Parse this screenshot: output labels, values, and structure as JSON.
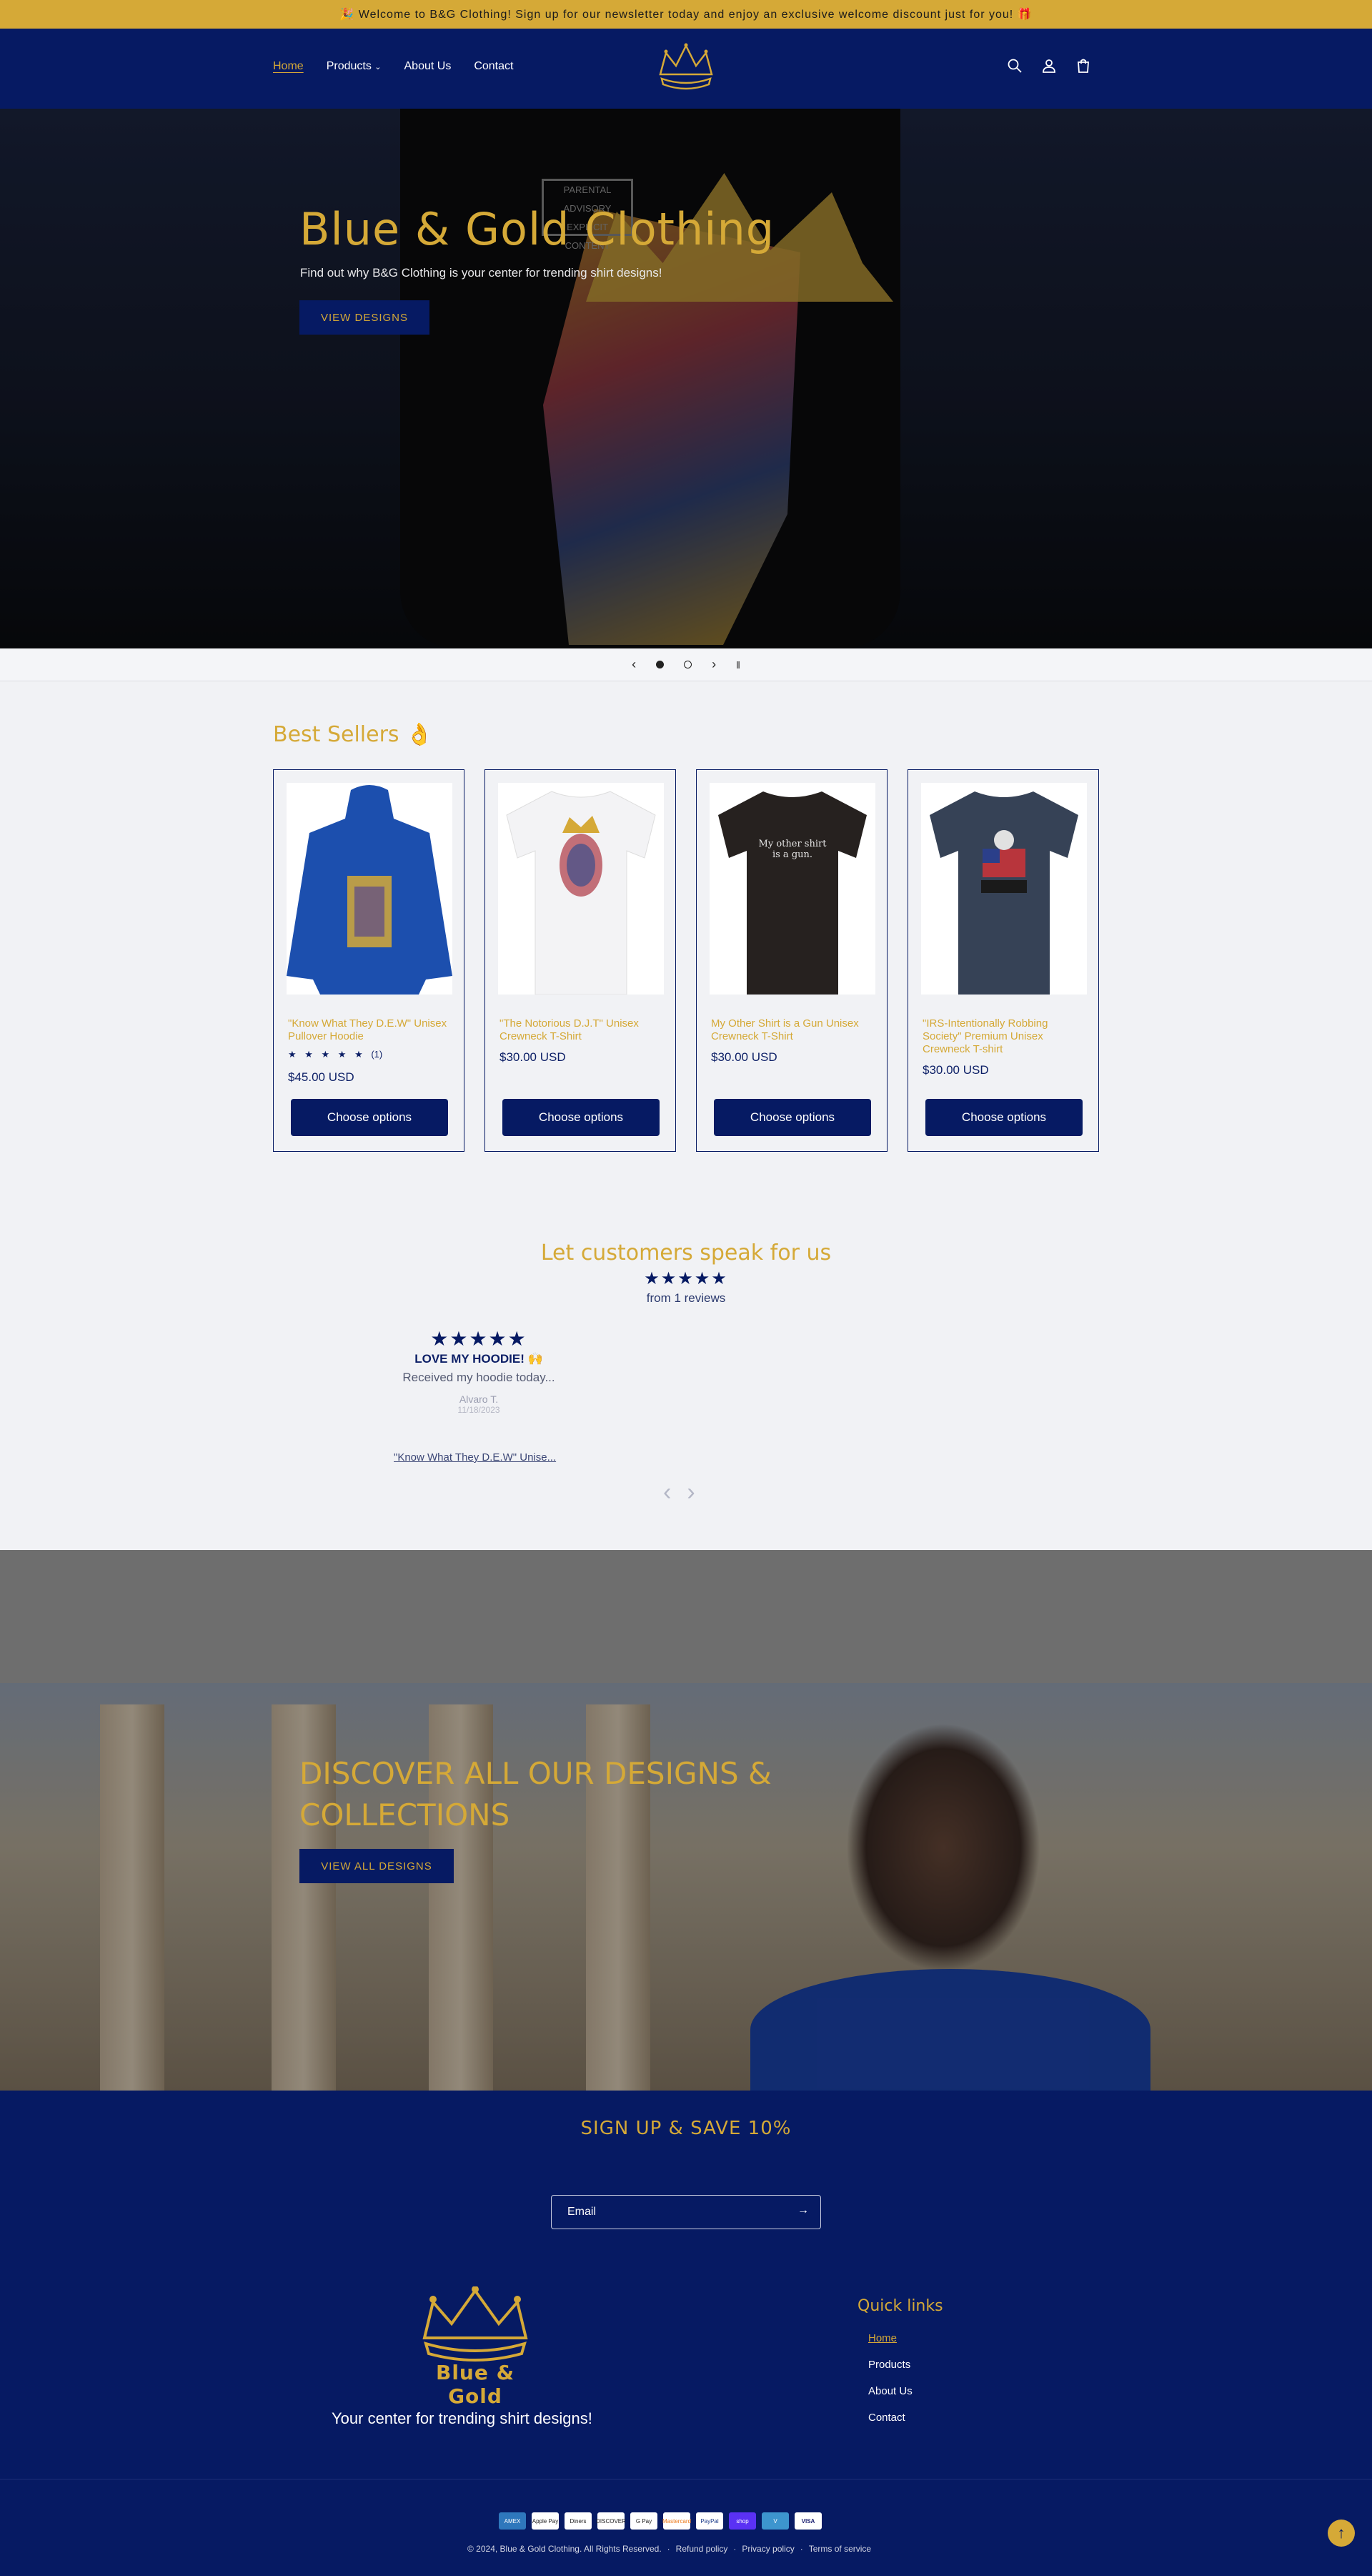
{
  "announcement": "🎉 Welcome to B&G Clothing! Sign up for our newsletter today and enjoy an exclusive welcome discount just for you! 🎁",
  "nav": [
    {
      "label": "Home",
      "active": true
    },
    {
      "label": "Products",
      "has_dropdown": true
    },
    {
      "label": "About Us"
    },
    {
      "label": "Contact"
    }
  ],
  "header_icons": [
    "search-icon",
    "account-icon",
    "cart-icon"
  ],
  "hero": {
    "title": "Blue & Gold Clothing",
    "subtitle": "Find out why B&G Clothing is your center for trending shirt designs!",
    "button": "VIEW DESIGNS",
    "advisory": "PARENTAL ADVISORY EXPLICIT CONTENT"
  },
  "slider": {
    "prev": "‹",
    "next": "›",
    "pause": "‖",
    "slides": 2,
    "current": 1
  },
  "best_sellers": {
    "title": "Best Sellers 👌",
    "products": [
      {
        "name": "\"Know What They D.E.W\" Unisex Pullover Hoodie",
        "rating_stars": "★ ★ ★ ★ ★",
        "rating_count": "(1)",
        "price": "$45.00 USD",
        "button": "Choose options"
      },
      {
        "name": "\"The Notorious D.J.T\" Unisex Crewneck T-Shirt",
        "price": "$30.00 USD",
        "button": "Choose options"
      },
      {
        "name": "My Other Shirt is a Gun Unisex Crewneck T-Shirt",
        "price": "$30.00 USD",
        "button": "Choose options",
        "print": "My other shirt is a gun."
      },
      {
        "name": "\"IRS-Intentionally Robbing Society\" Premium Unisex Crewneck T-shirt",
        "price": "$30.00 USD",
        "button": "Choose options"
      }
    ]
  },
  "reviews": {
    "title": "Let customers speak for us",
    "stars": "★★★★★",
    "from": "from 1 reviews",
    "review": {
      "stars": "★★★★★",
      "title": "LOVE MY HOODIE! 🙌",
      "body": "Received my hoodie today...",
      "author": "Alvaro T.",
      "date": "11/18/2023",
      "product": "\"Know What They D.E.W\" Unise..."
    },
    "prev": "‹",
    "next": "›"
  },
  "collection": {
    "title": "DISCOVER ALL OUR DESIGNS & COLLECTIONS",
    "button": "VIEW ALL DESIGNS"
  },
  "newsletter": {
    "title": "SIGN UP & SAVE 10%",
    "email_placeholder": "Email",
    "submit_arrow": "→"
  },
  "footer": {
    "brand": "Blue & Gold",
    "tagline": "Your center for trending shirt designs!",
    "quick_links_title": "Quick links",
    "quick_links": [
      {
        "label": "Home",
        "active": true
      },
      {
        "label": "Products"
      },
      {
        "label": "About Us"
      },
      {
        "label": "Contact"
      }
    ],
    "payments": [
      "AMEX",
      "Apple Pay",
      "Diners",
      "DISCOVER",
      "G Pay",
      "Mastercard",
      "PayPal",
      "shop",
      "V",
      "VISA"
    ],
    "copyright": "© 2024, Blue & Gold Clothing. All Rights Reserved.",
    "policies": [
      "Refund policy",
      "Privacy policy",
      "Terms of service"
    ]
  },
  "colors": {
    "navy": "#061a63",
    "gold": "#d5a937",
    "page_bg": "#f1f2f5"
  }
}
